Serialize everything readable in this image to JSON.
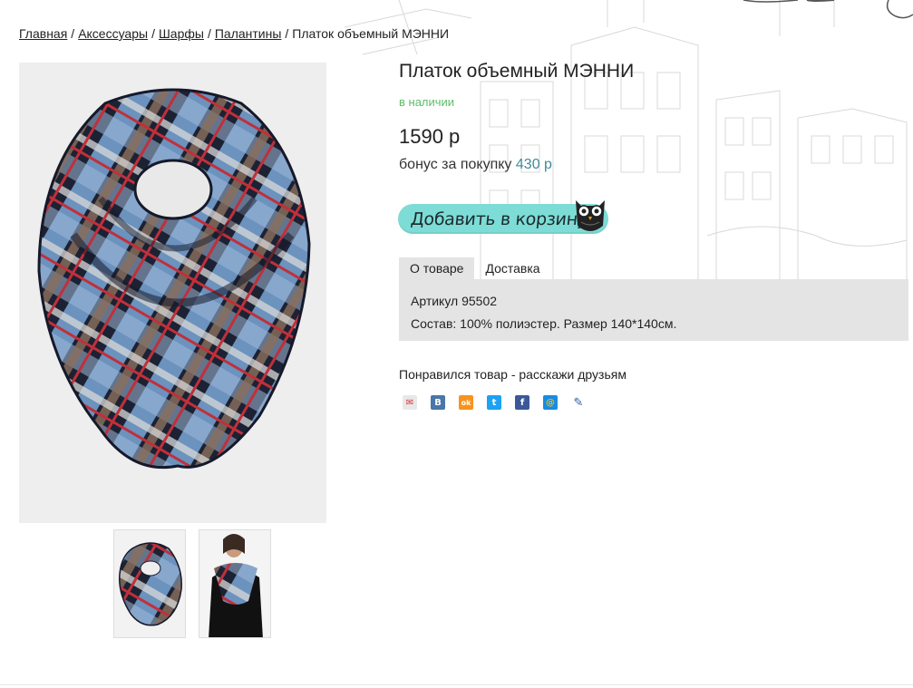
{
  "breadcrumb": {
    "items": [
      "Главная",
      "Аксессуары",
      "Шарфы",
      "Палантины"
    ],
    "separator": "/",
    "current": "Платок объемный МЭННИ"
  },
  "product": {
    "title": "Платок объемный МЭННИ",
    "stock_status": "в наличии",
    "price": "1590 р",
    "bonus_label": "бонус за покупку",
    "bonus_value": "430 р"
  },
  "cart_button": {
    "label": "Добавить в корзину"
  },
  "tabs": [
    {
      "label": "О товаре",
      "active": true
    },
    {
      "label": "Доставка",
      "active": false
    }
  ],
  "description": {
    "article": "Артикул 95502",
    "composition": "Состав: 100% полиэстер. Размер 140*140см."
  },
  "share": {
    "title": "Понравился товар - расскажи друзьям",
    "icons": [
      {
        "name": "mail-ru-agent-icon",
        "glyph": "✉",
        "color": "#e8e8e8"
      },
      {
        "name": "vk-icon",
        "glyph": "В",
        "color": "#4a76a8"
      },
      {
        "name": "odnoklassniki-icon",
        "glyph": "ok",
        "color": "#f7931e"
      },
      {
        "name": "twitter-icon",
        "glyph": "t",
        "color": "#1da1f2"
      },
      {
        "name": "facebook-icon",
        "glyph": "f",
        "color": "#3b5998"
      },
      {
        "name": "mail-ru-icon",
        "glyph": "@",
        "color": "#168de2"
      },
      {
        "name": "livejournal-icon",
        "glyph": "✎",
        "color": "#ffffff"
      }
    ]
  },
  "colors": {
    "stock_green": "#5fbd6a",
    "bonus_teal": "#3e8b98",
    "cart_button": "#7ddcd6",
    "tab_panel": "#e4e4e4"
  }
}
